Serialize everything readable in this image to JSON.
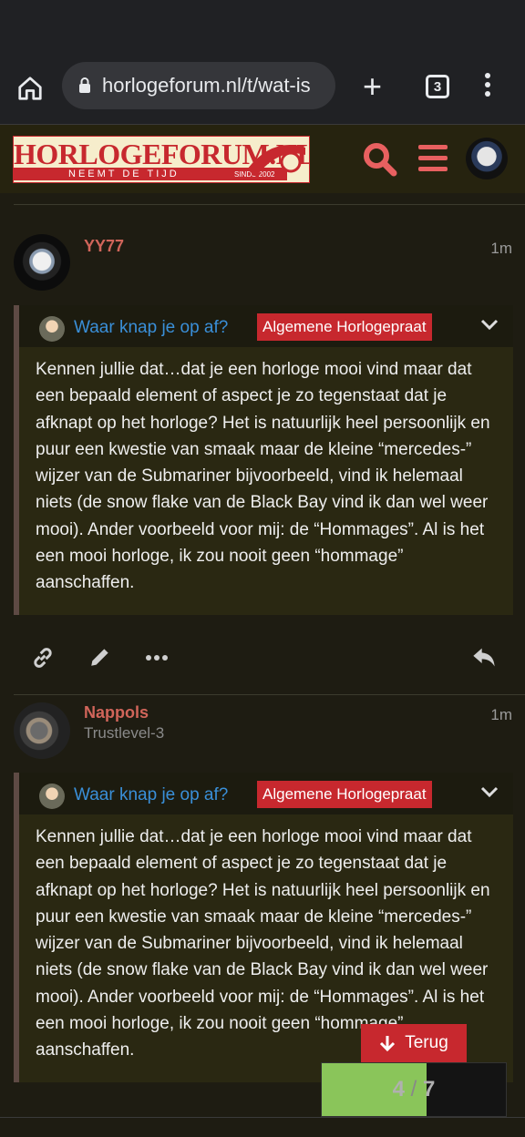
{
  "browser": {
    "url": "horlogeforum.nl/t/wat-is",
    "tab_count": "3",
    "icons": [
      "home-icon",
      "lock-icon",
      "plus-icon",
      "more-vert-icon"
    ]
  },
  "site": {
    "logo_title": "HORLOGEFORUM.NL",
    "logo_sub": "NEEMT DE TIJD",
    "logo_since": "SINDS 2002",
    "accent": "#c7282e",
    "icons": [
      "search-icon",
      "hamburger-icon"
    ]
  },
  "posts": [
    {
      "username": "YY77",
      "trust": "",
      "time": "1m",
      "quote": {
        "topic": "Waar knap je op af?",
        "category": "Algemene Horlogepraat",
        "body": "Kennen jullie dat…dat je een horloge mooi vind maar dat een bepaald element of aspect je zo tegenstaat dat je afknapt op het horloge? Het is natuurlijk heel persoonlijk en puur een kwestie van smaak maar de kleine “mercedes-” wijzer van de Submariner bijvoorbeeld, vind ik helemaal niets (de snow flake van de Black Bay vind ik dan wel weer mooi). Ander voorbeeld voor mij: de “Hommages”. Al is het een mooi horloge, ik zou nooit geen “hommage” aanschaffen."
      }
    },
    {
      "username": "Nappols",
      "trust": "Trustlevel-3",
      "time": "1m",
      "quote": {
        "topic": "Waar knap je op af?",
        "category": "Algemene Horlogepraat",
        "body": "Kennen jullie dat…dat je een horloge mooi vind maar dat een bepaald element of aspect je zo tegenstaat dat je afknapt op het horloge? Het is natuurlijk heel persoonlijk en puur een kwestie van smaak maar de kleine “mercedes-” wijzer van de Submariner bijvoorbeeld, vind ik helemaal niets (de snow flake van de Black Bay vind ik dan wel weer mooi). Ander voorbeeld voor mij: de “Hommages”. Al is het een mooi horloge, ik zou nooit geen “hommage” aanschaffen."
      }
    }
  ],
  "terug_label": "Terug",
  "progress": {
    "current": "4",
    "separator": "/",
    "total": "7",
    "fraction": 0.57
  }
}
